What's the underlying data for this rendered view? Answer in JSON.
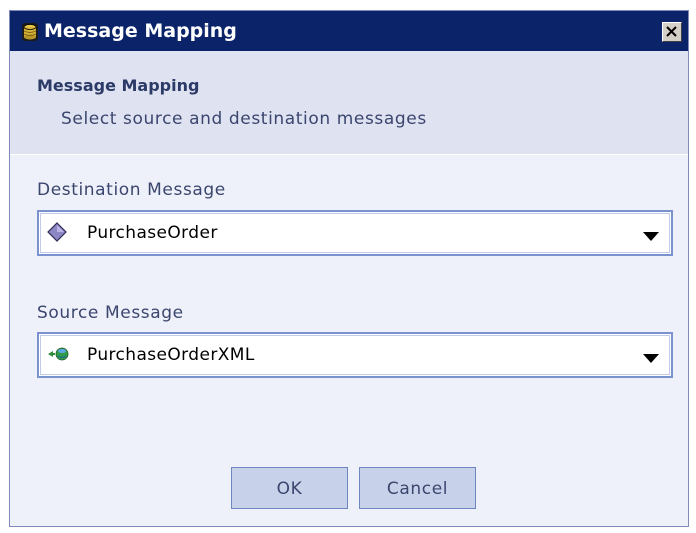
{
  "window": {
    "title": "Message Mapping",
    "close_icon": "close-icon"
  },
  "header": {
    "title": "Message Mapping",
    "subtitle": "Select source and destination messages"
  },
  "destination": {
    "label": "Destination Message",
    "value": "PurchaseOrder",
    "icon": "diamond-schema-icon"
  },
  "source": {
    "label": "Source Message",
    "value": "PurchaseOrderXML",
    "icon": "xml-message-icon"
  },
  "buttons": {
    "ok": "OK",
    "cancel": "Cancel"
  },
  "colors": {
    "titlebar": "#0a2369",
    "panel": "#eef0fa",
    "header_band": "#dfe2f1",
    "accent_border": "#7a93cf",
    "button_fill": "#c7d2ea"
  }
}
